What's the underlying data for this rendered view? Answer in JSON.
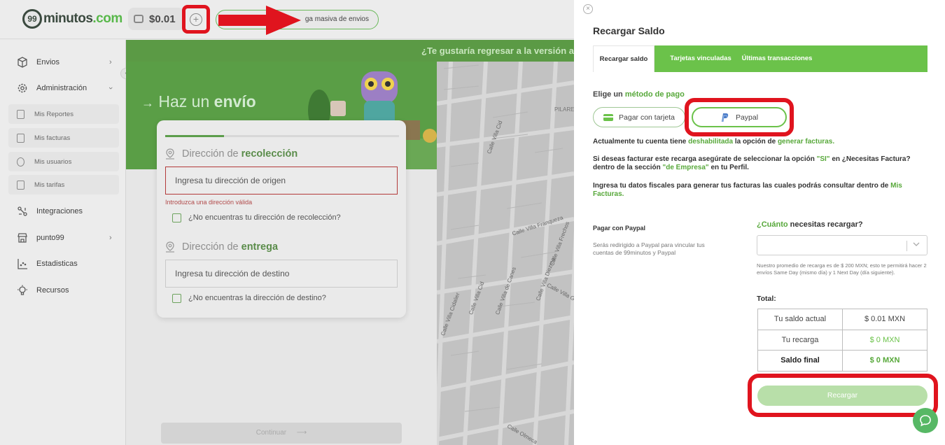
{
  "topbar": {
    "logo_number": "99",
    "logo_brand": "minutos",
    "logo_domain": ".com",
    "balance": "$0.01",
    "bulk_label": "ga masiva de envios"
  },
  "sidebar": {
    "items": [
      {
        "label": "Envios",
        "icon": "box-icon"
      },
      {
        "label": "Administración",
        "icon": "gear-icon"
      },
      {
        "label": "Integraciones",
        "icon": "integrations-icon"
      },
      {
        "label": "punto99",
        "icon": "store-icon"
      },
      {
        "label": "Estadisticas",
        "icon": "chart-icon"
      },
      {
        "label": "Recursos",
        "icon": "bulb-icon"
      }
    ],
    "sub_items": [
      {
        "label": "Mis Reportes"
      },
      {
        "label": "Mis facturas"
      },
      {
        "label": "Mis usuarios"
      },
      {
        "label": "Mis tarifas"
      }
    ]
  },
  "main": {
    "banner": "¿Te gustaría regresar a la versión an",
    "hero_prefix": "Haz un",
    "hero_bold": "envío",
    "pickup_title_prefix": "Dirección de",
    "pickup_title_bold": "recolección",
    "pickup_placeholder": "Ingresa tu dirección de origen",
    "pickup_error": "Introduzca una dirección válida",
    "pickup_missing": "¿No encuentras tu dirección de recolección?",
    "delivery_title_prefix": "Dirección de",
    "delivery_title_bold": "entrega",
    "delivery_placeholder": "Ingresa tu dirección de destino",
    "delivery_missing": "¿No encuentras la dirección de destino?",
    "continue_label": "Continuar",
    "map_streets": [
      "Calle Villa Cid",
      "Calle Villa Franqueza",
      "Calle Villa Frechos",
      "Calle Villa General",
      "Calle Villa Cidalier",
      "Calle Villa Diezma",
      "Calle Villa de Canes",
      "Calle Villa Cid",
      "Calle Olmeca",
      "PILARES"
    ]
  },
  "panel": {
    "title": "Recargar Saldo",
    "tabs": [
      {
        "label": "Recargar saldo",
        "active": true
      },
      {
        "label": "Tarjetas vinculadas",
        "active": false
      },
      {
        "label": "Últimas transacciones",
        "active": false
      }
    ],
    "method_prefix": "Elige un",
    "method_highlight": "método de pago",
    "pay_card": "Pagar con tarjeta",
    "pay_paypal": "Paypal",
    "info1_a": "Actualmente tu cuenta tiene",
    "info1_b": "deshabilitada",
    "info1_c": "la opción de",
    "info1_d": "generar facturas.",
    "info2_a": "Si deseas facturar este recarga asegúrate de seleccionar la opción",
    "info2_b": "\"SI\"",
    "info2_c": "en ¿Necesitas Factura? dentro de la sección",
    "info2_d": "\"de Empresa\"",
    "info2_e": "en tu Perfil.",
    "info3_a": "Ingresa tu datos fiscales para generar tus facturas las cuales podrás consultar dentro de",
    "info3_b": "Mis Facturas.",
    "paypal_title": "Pagar con Paypal",
    "paypal_desc": "Serás redirigido a Paypal para vincular tus cuentas de 99minutos y Paypal",
    "amount_q_hl": "¿Cuánto",
    "amount_q_rest": "necesitas recargar?",
    "amount_value": "",
    "avg_note": "Nuestro promedio de recarga es de $ 200 MXN; esto te permitirá hacer 2 envíos Same Day (mismo día) y 1 Next Day (día siguiente).",
    "total_label": "Total:",
    "totals": [
      {
        "label": "Tu saldo actual",
        "value": "$ 0.01 MXN"
      },
      {
        "label": "Tu recarga",
        "value": "$ 0 MXN"
      },
      {
        "label": "Saldo final",
        "value": "$ 0 MXN"
      }
    ],
    "recargar_label": "Recargar",
    "close_symbol": "×"
  },
  "colors": {
    "brand_green": "#6bc24a",
    "annotation_red": "#e0141e"
  }
}
